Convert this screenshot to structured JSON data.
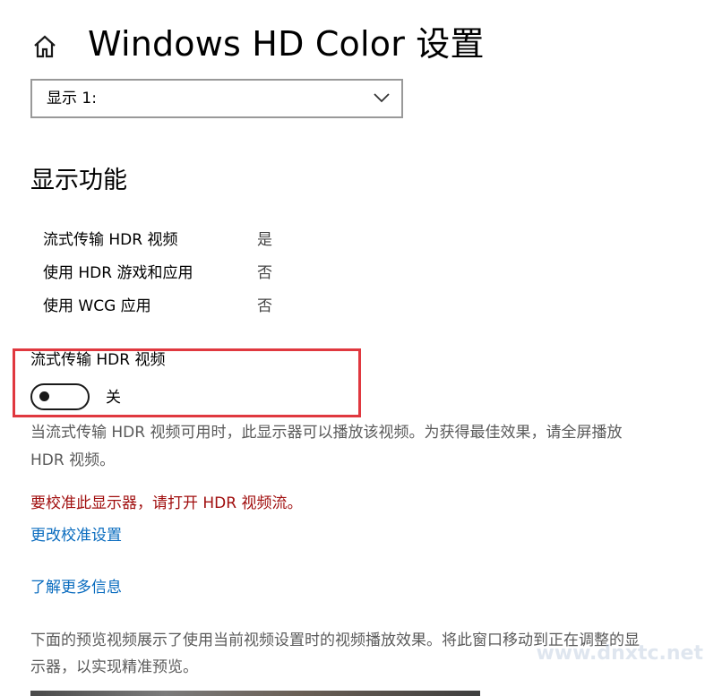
{
  "header": {
    "title": "Windows HD Color 设置",
    "home_icon": "home-icon"
  },
  "display_select": {
    "value": "显示 1:",
    "icon": "chevron-down-icon"
  },
  "capabilities": {
    "heading": "显示功能",
    "rows": [
      {
        "name": "流式传输 HDR 视频",
        "value": "是"
      },
      {
        "name": "使用 HDR 游戏和应用",
        "value": "否"
      },
      {
        "name": "使用 WCG 应用",
        "value": "否"
      }
    ]
  },
  "hdr_stream": {
    "label": "流式传输 HDR 视频",
    "toggle_on": false,
    "state_label": "关",
    "description": "当流式传输 HDR 视频可用时，此显示器可以播放该视频。为获得最佳效果，请全屏播放 HDR 视频。"
  },
  "calibration": {
    "warning": "要校准此显示器，请打开 HDR 视频流。",
    "link": "更改校准设置"
  },
  "learn_more": {
    "link": "了解更多信息"
  },
  "preview": {
    "description": "下面的预览视频展示了使用当前视频设置时的视频播放效果。将此窗口移动到正在调整的显示器，以实现精准预览。"
  },
  "watermark": {
    "text": "www.dnxtc.net"
  },
  "colors": {
    "highlight_border": "#e0383f",
    "warning_text": "#a10f0f",
    "link_text": "#0a6cbf"
  }
}
